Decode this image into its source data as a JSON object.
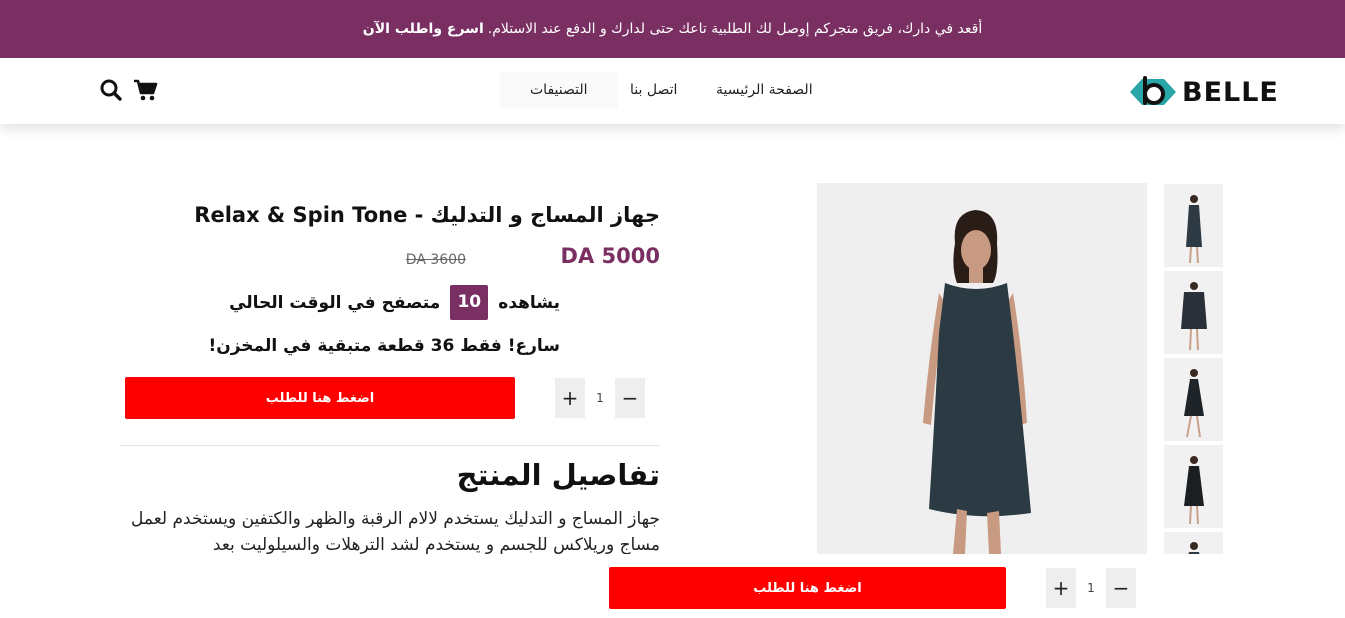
{
  "announcement": {
    "text": "أقعد في دارك، فريق متجركم إوصل لك الطلبية تاعك حتى لدارك و الدفع عند الاستلام.",
    "cta": "اسرع واطلب الآن"
  },
  "header": {
    "brand": "BELLE",
    "nav": {
      "home": "الصفحة الرئيسية",
      "contact": "اتصل بنا",
      "categories": "التصنيفات"
    },
    "icons": {
      "cart": "cart-icon",
      "search": "search-icon"
    }
  },
  "product": {
    "title": "جهاز المساج و التدليك - Relax & Spin Tone",
    "price": "DA 5000",
    "old_price": "DA 3600",
    "viewers": {
      "prefix": "يشاهده",
      "count": "10",
      "suffix": "متصفح في الوقت الحالي"
    },
    "stock_text": "سارع! فقط 36 قطعة متبقية في المخزن!",
    "quantity": "1",
    "order_label": "اضغط هنا للطلب",
    "details_title": "تفاصيل المنتج",
    "details_text": "جهاز المساج و التدليك يستخدم لالام الرقبة والظهر والكتفين ويستخدم لعمل مساج وريلاكس للجسم و يستخدم لشد الترهلات والسيلوليت بعد"
  },
  "sticky_bar": {
    "quantity": "1",
    "order_label": "اضغط هنا للطلب"
  },
  "colors": {
    "brand": "#7a2f62",
    "order_button": "#ff0000",
    "logo_accent": "#2aa6a8"
  }
}
